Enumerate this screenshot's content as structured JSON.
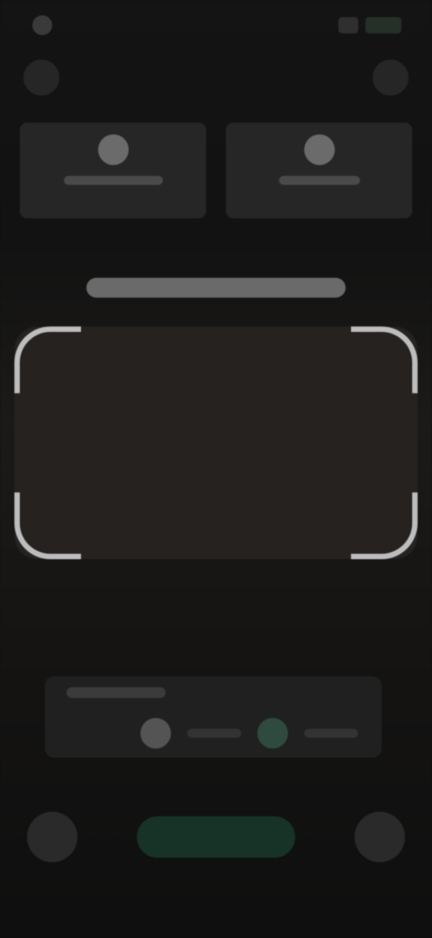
{
  "status_bar": {
    "time": "",
    "left_icons": [
      "camera-dot-icon"
    ],
    "right_icons": [
      "signal-icon",
      "battery-icon"
    ],
    "battery_color": "#2b3a30"
  },
  "toolbar": {
    "left_icon": "menu-dot-icon",
    "right_icon": "more-dot-icon"
  },
  "cards": [
    {
      "icon": "scan-icon",
      "label": ""
    },
    {
      "icon": "person-icon",
      "label": ""
    }
  ],
  "instruction": {
    "text": ""
  },
  "scan_area": {
    "frame_color": "#bdbdbd",
    "background": "#25221f"
  },
  "options_panel": {
    "title": "",
    "items": [
      {
        "icon": "option-icon",
        "active": false
      },
      {
        "icon": "option-active-icon",
        "active": true
      }
    ],
    "accent_color": "#2f4a3e"
  },
  "bottom_bar": {
    "left_icon": "gallery-icon",
    "primary_label": "",
    "right_icon": "flash-icon",
    "accent_color": "#173227"
  }
}
